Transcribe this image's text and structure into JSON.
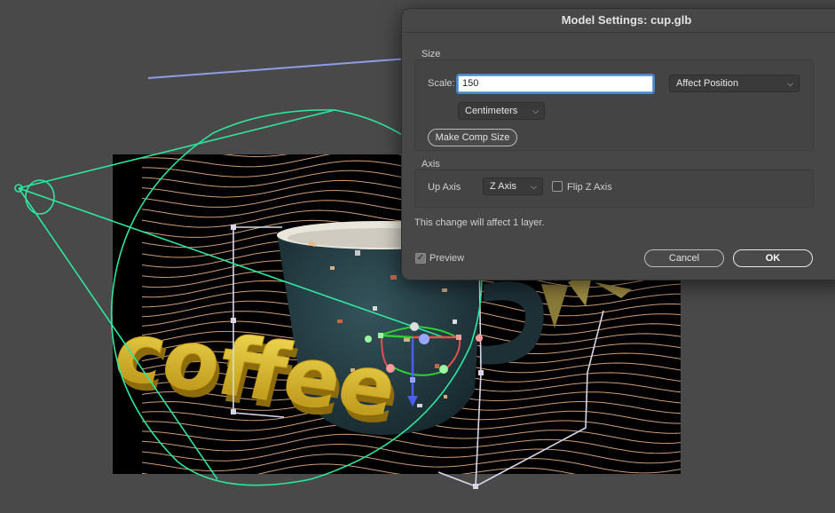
{
  "dialog": {
    "title": "Model Settings: cup.glb",
    "size": {
      "group_label": "Size",
      "scale_label": "Scale:",
      "scale_value": "150",
      "position_mode": "Affect Position",
      "units": "Centimeters",
      "make_comp_size_label": "Make Comp Size"
    },
    "axis": {
      "group_label": "Axis",
      "up_axis_label": "Up Axis",
      "up_axis_value": "Z Axis",
      "flip_label": "Flip Z Axis",
      "flip_checked": false
    },
    "info_text": "This change will affect 1 layer.",
    "preview_label": "Preview",
    "preview_checked": true,
    "cancel_label": "Cancel",
    "ok_label": "OK"
  },
  "scene": {
    "headline_text": "coffee",
    "icons": [
      "camera-cone",
      "transform-gizmo",
      "chevron-down-icon",
      "checkmark-icon"
    ],
    "colors": {
      "background": "#494949",
      "camera_wire": "#2ee6a0",
      "bounding_box": "#d7d7ea",
      "text_3d": "#e8c829",
      "cup": "#233a41",
      "wave_lines": "#f2b98a"
    }
  }
}
